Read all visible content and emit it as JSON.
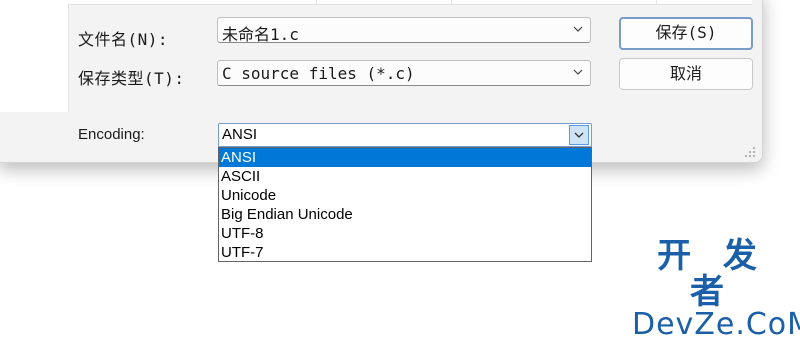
{
  "dialog": {
    "filename": {
      "label": "文件名(N):",
      "value": "未命名1.c"
    },
    "filetype": {
      "label": "保存类型(T):",
      "value": "C source files (*.c)"
    },
    "buttons": {
      "save": "保存(S)",
      "cancel": "取消"
    },
    "encoding": {
      "label": "Encoding:",
      "value": "ANSI",
      "options": [
        "ANSI",
        "ASCII",
        "Unicode",
        "Big Endian Unicode",
        "UTF-8",
        "UTF-7"
      ],
      "selected_index": 0
    }
  },
  "watermark": {
    "line1": "开 发 者",
    "line2": "DevZe.CoM"
  },
  "colors": {
    "selection": "#0078d7",
    "watermark": "#1a5fa8"
  }
}
